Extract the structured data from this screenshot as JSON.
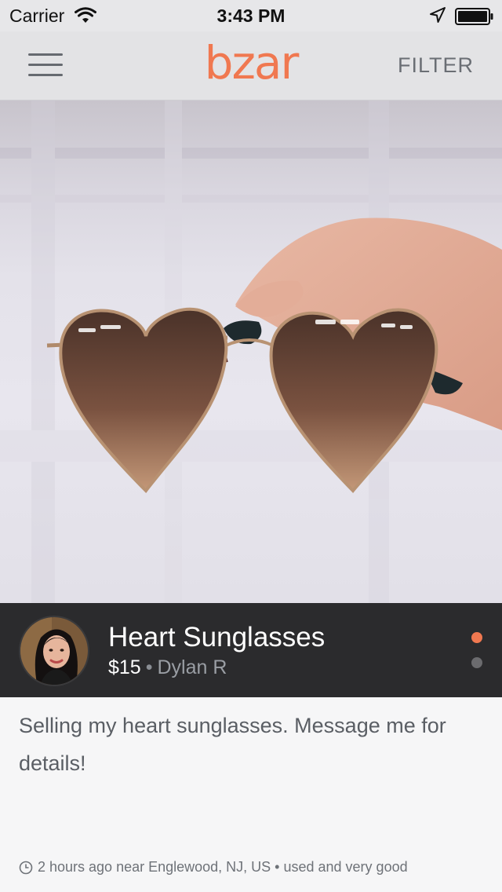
{
  "status_bar": {
    "carrier": "Carrier",
    "time": "3:43 PM"
  },
  "nav": {
    "logo": "bzar",
    "filter_label": "FILTER"
  },
  "listing": {
    "title": "Heart Sunglasses",
    "price": "$15",
    "separator": "•",
    "seller": "Dylan R",
    "description": "Selling my heart sunglasses. Message me for details!",
    "footer": "2 hours ago near Englewood, NJ, US • used and very good",
    "page_indicator": {
      "count": 2,
      "active": 1
    }
  },
  "colors": {
    "accent": "#f07850",
    "info_bar": "#2b2b2d"
  },
  "icons": [
    "wifi-icon",
    "location-arrow-icon",
    "battery-icon",
    "menu-icon",
    "clock-icon"
  ]
}
